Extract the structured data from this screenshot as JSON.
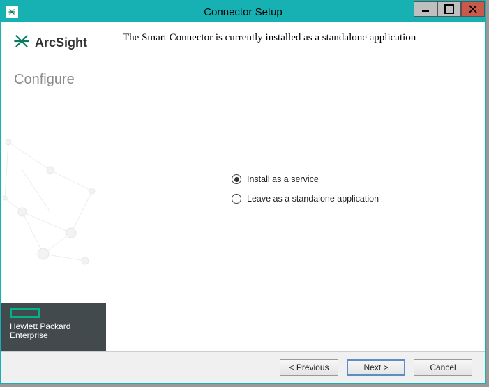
{
  "window": {
    "title": "Connector Setup"
  },
  "sidebar": {
    "brand": "ArcSight",
    "subtitle": "Configure",
    "vendor_line1": "Hewlett Packard",
    "vendor_line2": "Enterprise"
  },
  "main": {
    "headline": "The Smart Connector is currently installed as a standalone application",
    "options": [
      {
        "label": "Install as a service",
        "selected": true
      },
      {
        "label": "Leave as a standalone application",
        "selected": false
      }
    ]
  },
  "footer": {
    "previous": "< Previous",
    "next": "Next >",
    "cancel": "Cancel"
  }
}
